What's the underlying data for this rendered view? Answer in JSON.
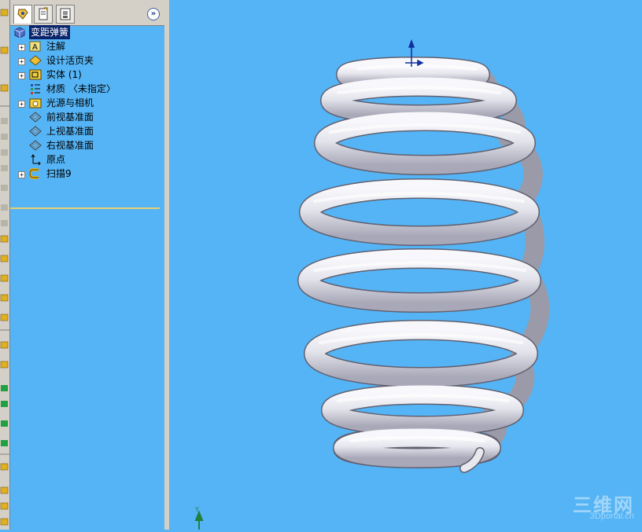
{
  "feature_tree": {
    "tabs": [
      "feature-manager",
      "property-manager",
      "configuration-manager"
    ],
    "root": "变距弹簧",
    "items": [
      {
        "label": "注解",
        "icon": "annotation-icon",
        "expandable": true
      },
      {
        "label": "设计活页夹",
        "icon": "design-binder-icon",
        "expandable": true
      },
      {
        "label": "实体 (1)",
        "icon": "solid-body-icon",
        "expandable": true
      },
      {
        "label": "材质 〈未指定〉",
        "icon": "material-icon",
        "expandable": false
      },
      {
        "label": "光源与相机",
        "icon": "lights-cameras-icon",
        "expandable": true
      },
      {
        "label": "前视基准面",
        "icon": "plane-icon",
        "expandable": false
      },
      {
        "label": "上视基准面",
        "icon": "plane-icon",
        "expandable": false
      },
      {
        "label": "右视基准面",
        "icon": "plane-icon",
        "expandable": false
      },
      {
        "label": "原点",
        "icon": "origin-icon",
        "expandable": false
      },
      {
        "label": "扫描9",
        "icon": "sweep-icon",
        "expandable": true
      }
    ]
  },
  "viewport": {
    "model": "variable-pitch-spring",
    "triad_label": "Y",
    "background": "#55b4f5"
  },
  "watermark": {
    "main": "三维网",
    "sub": "3Dportal.cn"
  }
}
